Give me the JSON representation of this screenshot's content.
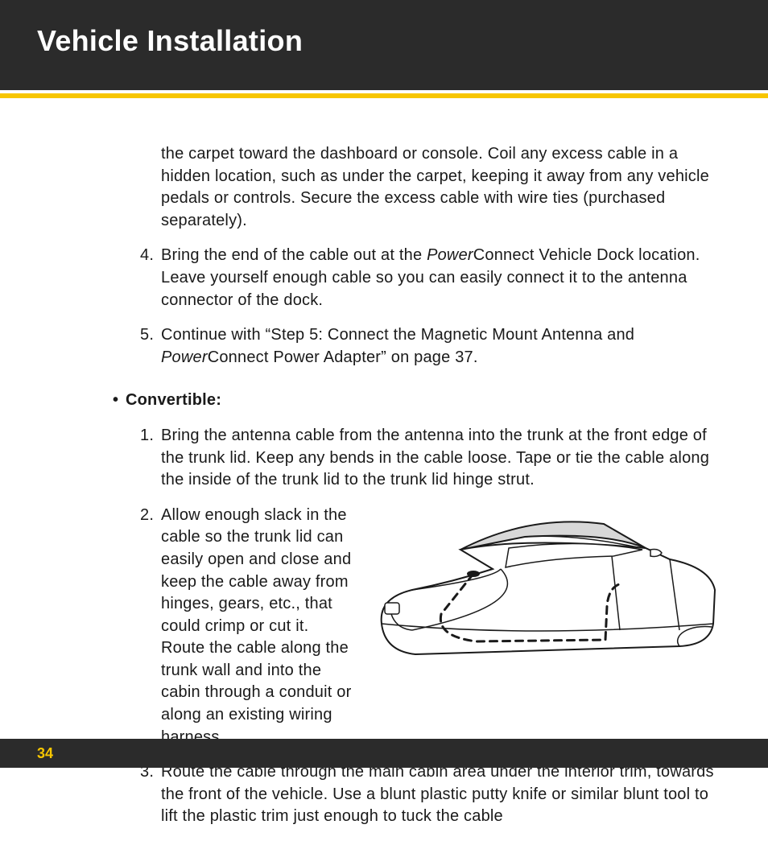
{
  "header": {
    "title": "Vehicle Installation"
  },
  "continuation_para": "the carpet toward the dashboard or console. Coil any excess cable in a hidden location, such as under the carpet, keeping it away from any vehicle pedals or controls. Secure the excess cable with wire ties (purchased separately).",
  "step4": {
    "num": "4.",
    "pre": "Bring the end of the cable out at the ",
    "italic": "Power",
    "post": "Connect Vehicle Dock location. Leave yourself enough cable so you can easily connect it to the antenna connector of the dock."
  },
  "step5": {
    "num": "5.",
    "pre": "Continue with “Step 5: Connect the Magnetic Mount Antenna and ",
    "italic": "Power",
    "post": "Connect Power Adapter” on page 37."
  },
  "subhead": "Convertible:",
  "conv1": {
    "num": "1.",
    "text": "Bring the antenna cable from the antenna into the trunk at the front edge of the trunk lid. Keep any bends in the cable loose. Tape or tie the cable along the inside of the trunk lid to the trunk lid hinge strut."
  },
  "conv2": {
    "num": "2.",
    "text": "Allow enough slack in the cable so the trunk lid can easily open and close and keep the cable away from hinges, gears, etc., that could crimp or cut it. Route the cable along the trunk wall and into the cabin through a conduit or along an existing wiring harness."
  },
  "conv3": {
    "num": "3.",
    "text": "Route the cable through the main cabin area under the interior trim, towards the front of the vehicle. Use a blunt plastic putty knife or similar blunt tool to lift the plastic trim just enough to tuck the cable"
  },
  "page_number": "34"
}
